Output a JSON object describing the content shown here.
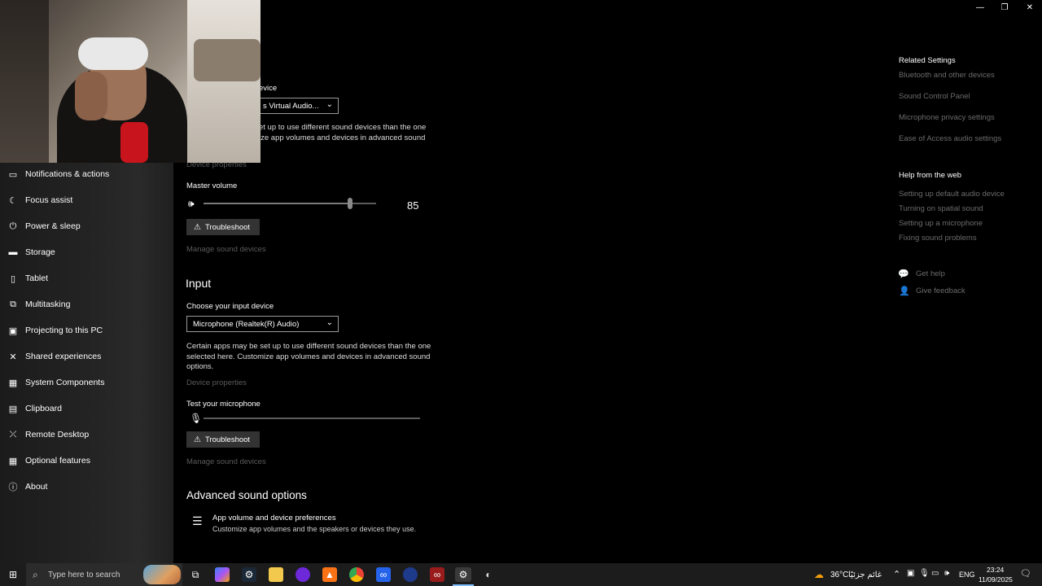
{
  "window": {
    "minimize_icon": "minimize-icon",
    "restore_icon": "restore-icon",
    "close_icon": "close-icon"
  },
  "sidebar": {
    "items": [
      {
        "label": "Notifications & actions",
        "icon": "notification-icon"
      },
      {
        "label": "Focus assist",
        "icon": "moon-icon"
      },
      {
        "label": "Power & sleep",
        "icon": "power-icon"
      },
      {
        "label": "Storage",
        "icon": "storage-icon"
      },
      {
        "label": "Tablet",
        "icon": "tablet-icon"
      },
      {
        "label": "Multitasking",
        "icon": "multitasking-icon"
      },
      {
        "label": "Projecting to this PC",
        "icon": "projecting-icon"
      },
      {
        "label": "Shared experiences",
        "icon": "shared-icon"
      },
      {
        "label": "System Components",
        "icon": "components-icon"
      },
      {
        "label": "Clipboard",
        "icon": "clipboard-icon"
      },
      {
        "label": "Remote Desktop",
        "icon": "remote-desktop-icon"
      },
      {
        "label": "Optional features",
        "icon": "optional-features-icon"
      },
      {
        "label": "About",
        "icon": "info-icon"
      }
    ]
  },
  "output": {
    "choose_label_partial": "evice",
    "device_value_partial": "s Virtual Audio...",
    "desc_line1_partial": "et up to use different sound devices than the one",
    "desc_line2_partial": "ize app volumes and devices in advanced sound",
    "device_properties": "Device properties",
    "master_volume_label": "Master volume",
    "volume_value": "85",
    "volume_level": 85,
    "troubleshoot": "Troubleshoot",
    "manage_devices": "Manage sound devices"
  },
  "input": {
    "heading": "Input",
    "choose_label": "Choose your input device",
    "device_value": "Microphone (Realtek(R) Audio)",
    "desc_line1": "Certain apps may be set up to use different sound devices than the one",
    "desc_line2": "selected here. Customize app volumes and devices in advanced sound",
    "desc_line3": "options.",
    "device_properties": "Device properties",
    "test_label": "Test your microphone",
    "troubleshoot": "Troubleshoot",
    "manage_devices": "Manage sound devices"
  },
  "advanced": {
    "heading": "Advanced sound options",
    "app_volume_title": "App volume and device preferences",
    "app_volume_desc": "Customize app volumes and the speakers or devices they use."
  },
  "related": {
    "heading": "Related Settings",
    "links": [
      "Bluetooth and other devices",
      "Sound Control Panel",
      "Microphone privacy settings",
      "Ease of Access audio settings"
    ]
  },
  "help": {
    "heading": "Help from the web",
    "links": [
      "Setting up default audio device",
      "Turning on spatial sound",
      "Setting up a microphone",
      "Fixing sound problems"
    ],
    "get_help": "Get help",
    "give_feedback": "Give feedback"
  },
  "taskbar": {
    "search_placeholder": "Type here to search",
    "weather_temp": "36°C",
    "weather_text": "غائم جزئيًا",
    "language": "ENG",
    "time": "23:24",
    "date": "11/09/2025"
  }
}
